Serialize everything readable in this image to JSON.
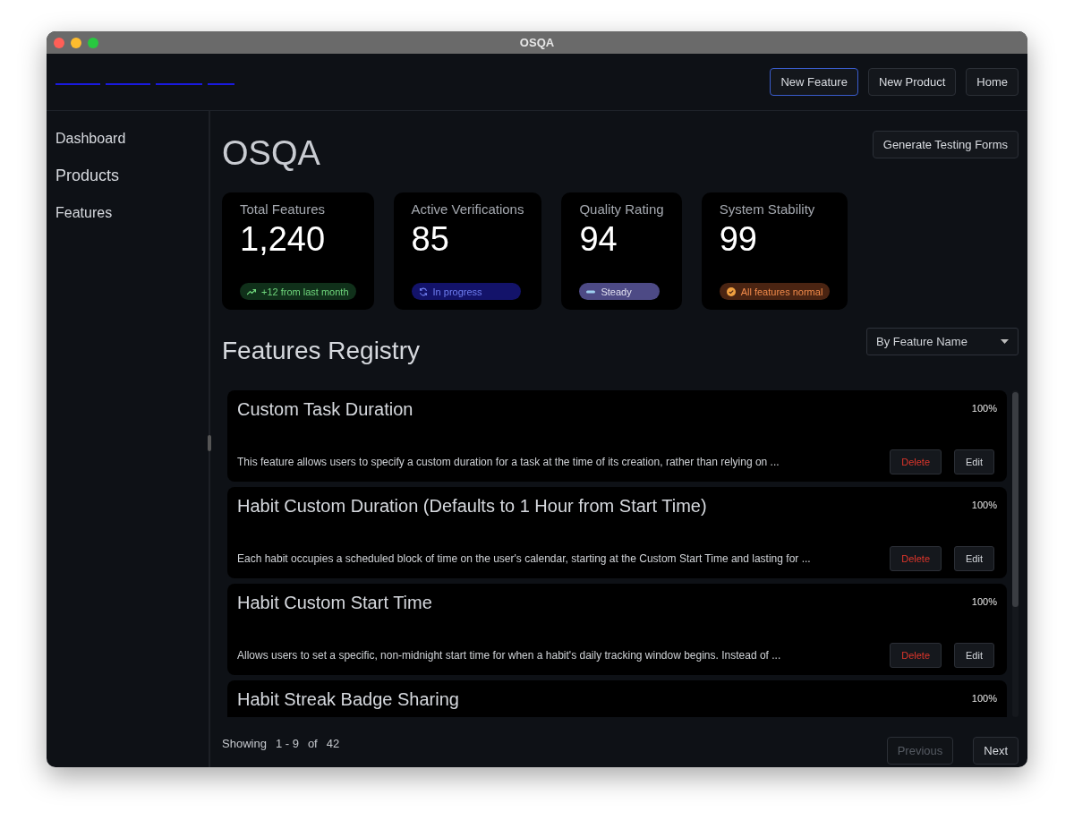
{
  "window": {
    "title": "OSQA"
  },
  "nav_buttons": [
    {
      "label": "New Feature",
      "active": true
    },
    {
      "label": "New Product",
      "active": false
    },
    {
      "label": "Home",
      "active": false
    }
  ],
  "sidebar": {
    "items": [
      {
        "label": "Dashboard"
      },
      {
        "label": "Products"
      },
      {
        "label": "Features"
      }
    ]
  },
  "page": {
    "title": "OSQA",
    "action": "Generate Testing Forms"
  },
  "stats": [
    {
      "label": "Total Features",
      "value": "1,240",
      "badge": "+12 from last month",
      "kind": "trend"
    },
    {
      "label": "Active Verifications",
      "value": "85",
      "badge": "In progress",
      "kind": "progress"
    },
    {
      "label": "Quality Rating",
      "value": "94",
      "badge": "Steady",
      "kind": "steady"
    },
    {
      "label": "System Stability",
      "value": "99",
      "badge": "All features normal",
      "kind": "normal"
    }
  ],
  "registry": {
    "title": "Features Registry",
    "sort": "By Feature Name",
    "features": [
      {
        "name": "Custom Task Duration",
        "percent": "100%",
        "description": "This feature allows users to specify a custom duration for a task at the time of its creation, rather than relying on ...",
        "delete": "Delete",
        "edit": "Edit"
      },
      {
        "name": "Habit Custom Duration (Defaults to 1 Hour from Start Time)",
        "percent": "100%",
        "description": "Each habit occupies a scheduled block of time on the user's calendar, starting at the Custom Start Time and lasting for ...",
        "delete": "Delete",
        "edit": "Edit"
      },
      {
        "name": "Habit Custom Start Time",
        "percent": "100%",
        "description": "Allows users to set a specific, non-midnight start time for when a habit's daily tracking window begins. Instead of ...",
        "delete": "Delete",
        "edit": "Edit"
      },
      {
        "name": "Habit Streak Badge Sharing",
        "percent": "100%"
      }
    ]
  },
  "pagination": {
    "showing": "Showing",
    "range": "1 - 9",
    "of": "of",
    "total": "42",
    "buttons": [
      {
        "label": "Previous",
        "disabled": true
      },
      {
        "label": "Next",
        "disabled": false
      }
    ]
  }
}
